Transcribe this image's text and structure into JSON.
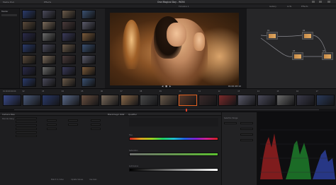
{
  "app": {
    "menu": [
      "Media Pool",
      "Effects"
    ],
    "project_title": "One Magical Day - R636",
    "timeline_name": "Timeline 1",
    "right_tabs": [
      "Gallery",
      "LUTs",
      "Effects"
    ]
  },
  "media_panel": {
    "label": "Master",
    "thumbs": 28
  },
  "viewer": {
    "timecode": "01:00:28:10"
  },
  "nodes": {
    "labels": [
      "01",
      "02",
      "03",
      "04"
    ]
  },
  "clip_strip": {
    "count": 17,
    "labels": [
      "01 00:00:00:00",
      "02",
      "03",
      "04",
      "05",
      "06",
      "07",
      "08",
      "09",
      "10",
      "11",
      "12",
      "13",
      "14",
      "15",
      "16",
      "17"
    ]
  },
  "bottom": {
    "camera_raw": "Camera Raw",
    "decode": "Decode Using",
    "color_wheels": "Blackmagic RAW",
    "curves_title": "Qualifier",
    "hue_label": "Hue",
    "saturation_label": "Saturation",
    "luminance_label": "Luminance",
    "selection_range": "Selection Range",
    "scopes_title": "Scopes",
    "buttons": [
      "Match to Video",
      "Update Values",
      "Use Gain"
    ]
  }
}
